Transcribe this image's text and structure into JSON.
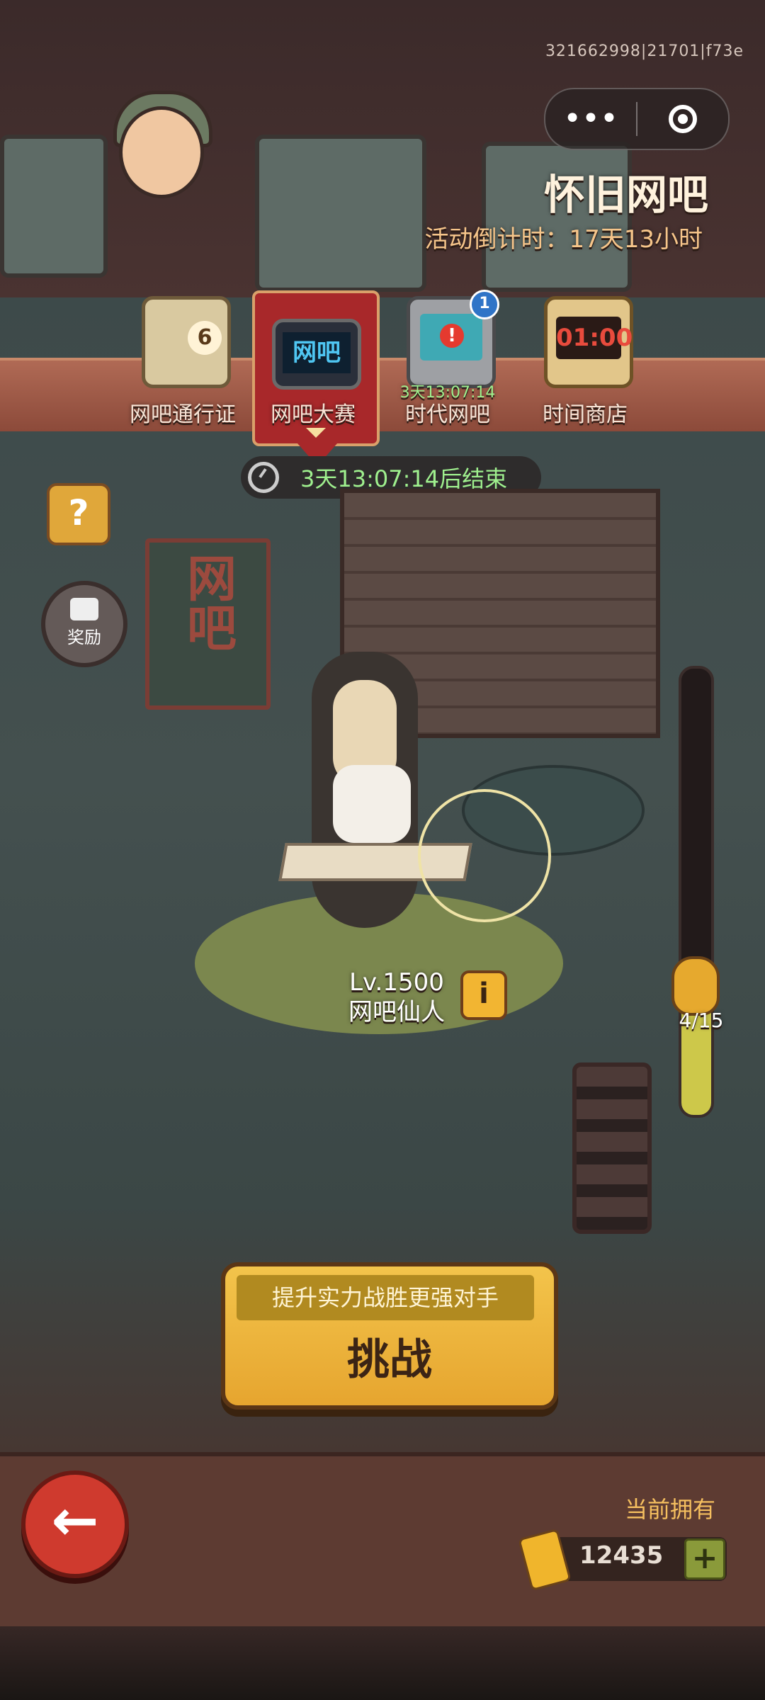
{
  "session_id": "321662998|21701|f73e",
  "capsule": {
    "more_icon": "more-dots-icon",
    "close_icon": "target-circle-icon"
  },
  "header": {
    "title": "怀旧网吧",
    "countdown": "活动倒计时：17天13小时"
  },
  "tabs": [
    {
      "label": "网吧通行证",
      "icon": "pass-jar-icon",
      "badge": "6"
    },
    {
      "label": "网吧大赛",
      "icon": "monitor-net-icon",
      "screen_text": "网吧",
      "selected": true
    },
    {
      "label": "时代网吧",
      "icon": "monitor-alert-icon",
      "badge": "1",
      "sub": "3天13:07:14"
    },
    {
      "label": "时间商店",
      "icon": "alarm-clock-icon",
      "screen_text": "01:00"
    }
  ],
  "event_timer": "3天13:07:14后结束",
  "side": {
    "help": "?",
    "reward_label": "奖励"
  },
  "sign_text": "网吧",
  "opponent": {
    "level": "Lv.1500",
    "name": "网吧仙人"
  },
  "progress": {
    "label": "4/15",
    "current": 4,
    "max": 15,
    "fill_color": "#cdc84a"
  },
  "challenge": {
    "subtitle": "提升实力战胜更强对手",
    "label": "挑战"
  },
  "currency": {
    "label": "当前拥有",
    "value": "12435",
    "icon": "gold-ticket-icon",
    "plus": "+"
  },
  "colors": {
    "accent": "#e6a52f",
    "timer_text": "#9ff08e",
    "ribbon": "#a8282a"
  }
}
